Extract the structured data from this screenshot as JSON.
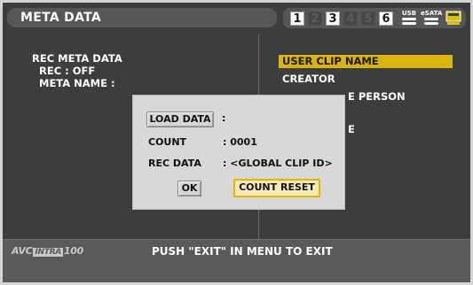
{
  "header": {
    "title": "META DATA",
    "slots": [
      {
        "label": "1",
        "active": true
      },
      {
        "label": "2",
        "active": false
      },
      {
        "label": "3",
        "active": true
      },
      {
        "label": "4",
        "active": false
      },
      {
        "label": "5",
        "active": false
      },
      {
        "label": "6",
        "active": true
      }
    ],
    "usb_label": "USB",
    "esata_label": "eSATA",
    "sd_color": "#d8c300"
  },
  "left_panel": {
    "heading": "REC META DATA",
    "rec_line": "REC : OFF",
    "meta_name_line": "META NAME :"
  },
  "right_panel": {
    "items": [
      {
        "label": "USER CLIP NAME",
        "selected": true
      },
      {
        "label": "CREATOR",
        "selected": false
      },
      {
        "label": "E PERSON",
        "selected": false
      },
      {
        "label": "E",
        "selected": false
      }
    ]
  },
  "dialog": {
    "load_data_button": "LOAD DATA",
    "load_data_colon": ":",
    "count_label": "COUNT",
    "count_value": ": 0001",
    "rec_data_label": "REC DATA",
    "rec_data_value": ": <GLOBAL CLIP ID>",
    "ok_button": "OK",
    "count_reset_button": "COUNT RESET"
  },
  "footer": {
    "logo_prefix": "AVC",
    "logo_intra": "INTRA",
    "logo_suffix": "100",
    "hint": "PUSH \"EXIT\" IN MENU TO EXIT"
  },
  "colors": {
    "background": "#3d3d3d",
    "highlight": "#d9b40f",
    "dialog": "#d8d8d8"
  }
}
